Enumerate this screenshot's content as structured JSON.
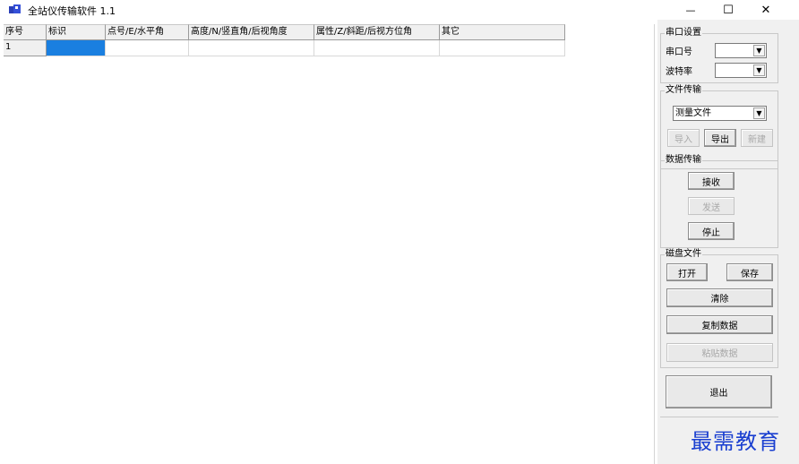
{
  "window": {
    "title": "全站仪传输软件 1.1",
    "icon": "app-cube-icon",
    "minimize_glyph": "—",
    "maximize_glyph": "☐",
    "close_glyph": "✕"
  },
  "grid": {
    "columns": [
      "序号",
      "标识",
      "点号/E/水平角",
      "高度/N/竖直角/后视角度",
      "属性/Z/斜距/后视方位角",
      "其它"
    ],
    "rows": [
      {
        "index": "1",
        "cells": [
          "",
          "",
          "",
          "",
          ""
        ]
      }
    ],
    "selection_color": "#1a7fe0"
  },
  "serial": {
    "title": "串口设置",
    "port_label": "串口号",
    "port_value": "",
    "baud_label": "波特率",
    "baud_value": ""
  },
  "file_transfer": {
    "title": "文件传输",
    "file_type_value": "测量文件",
    "import_label": "导入",
    "export_label": "导出",
    "new_label": "新建"
  },
  "data_transfer": {
    "title": "数据传输",
    "receive_label": "接收",
    "send_label": "发送",
    "stop_label": "停止"
  },
  "disk_file": {
    "title": "磁盘文件",
    "open_label": "打开",
    "save_label": "保存",
    "clear_label": "清除",
    "copy_label": "复制数据",
    "paste_label": "粘贴数据"
  },
  "exit_label": "退出",
  "watermark": "最需教育"
}
